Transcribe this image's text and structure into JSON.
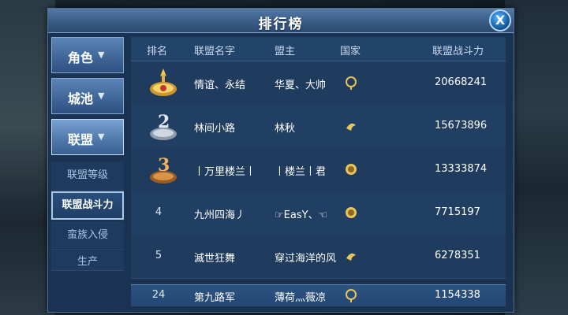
{
  "title": "排行榜",
  "close_label": "X",
  "menu": {
    "tabs": [
      {
        "label": "角色",
        "arrow": "▼"
      },
      {
        "label": "城池",
        "arrow": "▼"
      },
      {
        "label": "联盟",
        "arrow": "▼"
      }
    ],
    "subitems": [
      {
        "label": "联盟等级"
      },
      {
        "label": "联盟战斗力"
      },
      {
        "label": "蛮族入侵"
      },
      {
        "label": "生产"
      }
    ]
  },
  "table": {
    "headers": [
      "排名",
      "联盟名字",
      "盟主",
      "国家",
      "联盟战斗力"
    ],
    "rows": [
      {
        "rank": "",
        "medal": "gold-medal-icon",
        "alliance": "情谊、永结",
        "leader": "华夏、大帅",
        "country_icon": "country-emblem-icon",
        "power": "20668241"
      },
      {
        "rank": "",
        "medal": "silver-medal-icon",
        "alliance": "林间小路",
        "leader": "林秋",
        "country_icon": "country-emblem-icon",
        "power": "15673896"
      },
      {
        "rank": "",
        "medal": "bronze-medal-icon",
        "alliance": "丨万里楼兰丨",
        "leader": "丨楼兰丨君",
        "country_icon": "country-emblem-icon",
        "power": "13333874"
      },
      {
        "rank": "4",
        "medal": "",
        "alliance": "九州四海丿",
        "leader": "☞EasY、☜",
        "country_icon": "country-emblem-icon",
        "power": "7715197"
      },
      {
        "rank": "5",
        "medal": "",
        "alliance": "滅世狂舞",
        "leader": "穿过海洋的风",
        "country_icon": "country-emblem-icon",
        "power": "6278351"
      }
    ],
    "my_row": {
      "rank": "24",
      "alliance": "第九路军",
      "leader": "薄荷灬薇凉",
      "country_icon": "country-emblem-icon",
      "power": "1154338"
    }
  },
  "colors": {
    "panel": "#1b3352",
    "title_bar": "#3a5c86",
    "gold": "#e0b040",
    "silver": "#c9d3de",
    "bronze": "#d08a3a"
  }
}
